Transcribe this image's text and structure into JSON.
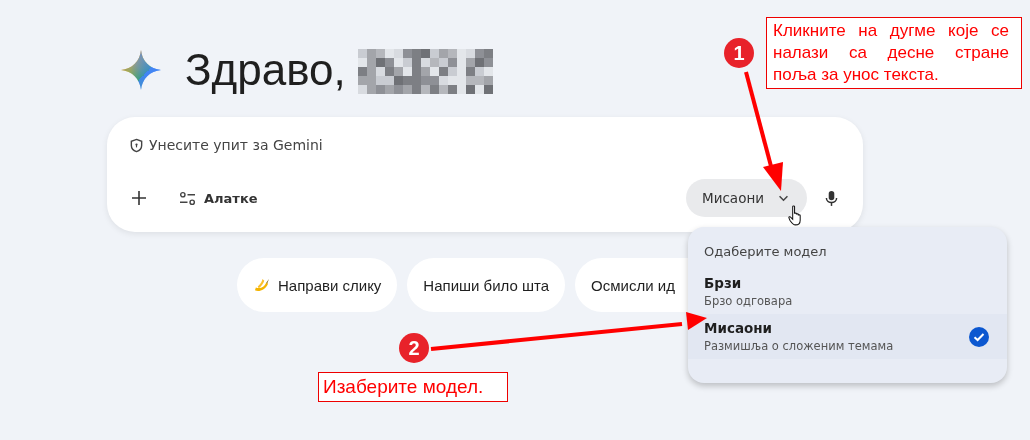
{
  "greeting": {
    "text": "Здраво,"
  },
  "prompt": {
    "placeholder": "Унесите упит за Gemini"
  },
  "toolbar": {
    "tools_label": "Алатке",
    "model_button": "Мисаони"
  },
  "suggestions": [
    {
      "label": "Направи слику"
    },
    {
      "label": "Напиши било шта",
      "kind": "text"
    },
    {
      "label": "Осмисли ид",
      "kind": "text"
    }
  ],
  "model_menu": {
    "title": "Одаберите модел",
    "options": [
      {
        "name": "Брзи",
        "description": "Брзо одговара",
        "selected": false
      },
      {
        "name": "Мисаони",
        "description": "Размишља о сложеним темама",
        "selected": true
      }
    ]
  },
  "annotations": [
    {
      "number": "1",
      "text": "Кликните на дугме које се налази са десне стране поља за унос текста."
    },
    {
      "number": "2",
      "text": "Изаберите модел."
    }
  ]
}
